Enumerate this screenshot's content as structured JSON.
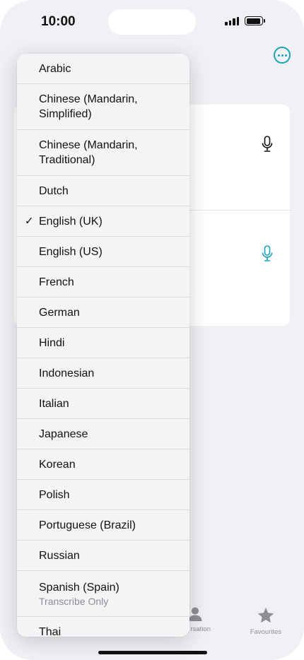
{
  "status_bar": {
    "time": "10:00"
  },
  "menu": {
    "selected": "English (UK)",
    "items": [
      {
        "label": "Arabic"
      },
      {
        "label": "Chinese (Mandarin, Simplified)"
      },
      {
        "label": "Chinese (Mandarin, Traditional)"
      },
      {
        "label": "Dutch"
      },
      {
        "label": "English (UK)",
        "checked": true
      },
      {
        "label": "English (US)"
      },
      {
        "label": "French"
      },
      {
        "label": "German"
      },
      {
        "label": "Hindi"
      },
      {
        "label": "Indonesian"
      },
      {
        "label": "Italian"
      },
      {
        "label": "Japanese"
      },
      {
        "label": "Korean"
      },
      {
        "label": "Polish"
      },
      {
        "label": "Portuguese (Brazil)"
      },
      {
        "label": "Russian"
      },
      {
        "label": "Spanish (Spain)",
        "sublabel": "Transcribe Only"
      },
      {
        "label": "Thai"
      }
    ]
  },
  "tab_bar": {
    "conversation_label": "rsation",
    "favourites_label": "Favourites"
  },
  "icons": {
    "check": "✓",
    "more": "ellipsis-circle-icon",
    "mic": "microphone-icon",
    "person": "person-icon",
    "star": "star-icon"
  },
  "colors": {
    "accent": "#17a2b8",
    "menu_bg": "#f4f4f6",
    "app_bg": "#f1f1f5"
  }
}
